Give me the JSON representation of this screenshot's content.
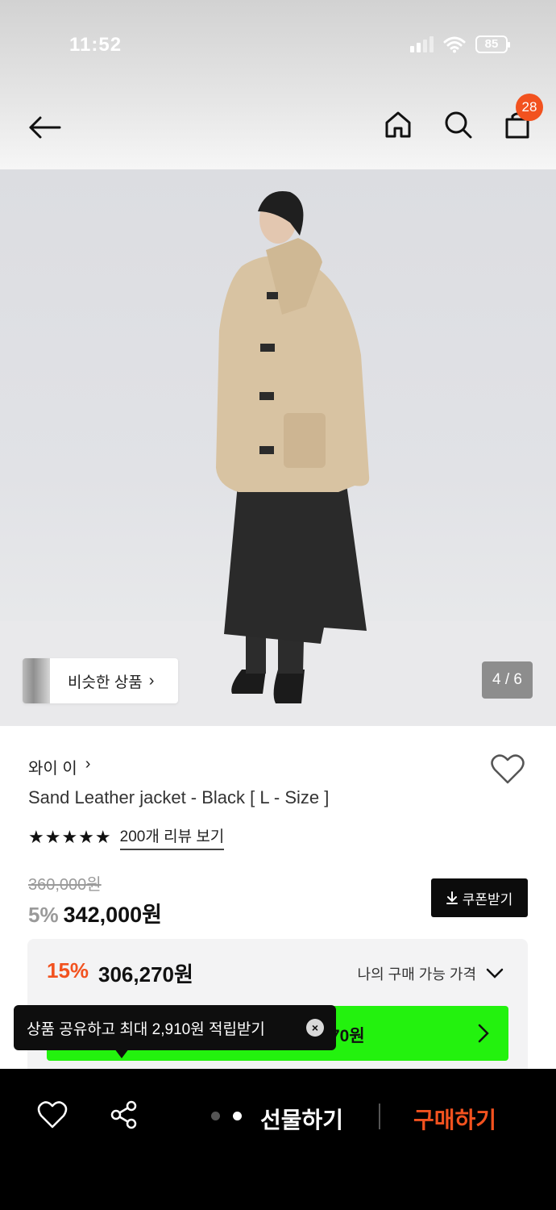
{
  "status_bar": {
    "time": "11:52",
    "battery": "85"
  },
  "header": {
    "cart_count": "28"
  },
  "gallery": {
    "similar_label": "비슷한 상품",
    "similar_chevron": "›",
    "page_indicator": "4 / 6"
  },
  "product": {
    "brand": "와이 이",
    "brand_chevron": "›",
    "title": "Sand Leather jacket - Black [ L - Size ]",
    "stars": "★★★★★",
    "review_link": "200개 리뷰 보기",
    "original_price": "360,000원",
    "discount": "5%",
    "price": "342,000원",
    "coupon_label": "쿠폰받기"
  },
  "my_price": {
    "discount": "15%",
    "price": "306,270원",
    "label": "나의 구매 가능 가격"
  },
  "promo": {
    "partial_text": "70원"
  },
  "tooltip": {
    "text": "상품 공유하고 최대 2,910원 적립받기",
    "close": "×"
  },
  "bottom": {
    "gift_label": "선물하기",
    "buy_label": "구매하기"
  },
  "colors": {
    "accent": "#f2521f",
    "promo_green": "#23f20e",
    "coat": "#d8c3a2",
    "skirt": "#2a2a2a"
  },
  "icons": [
    "back-arrow-icon",
    "home-icon",
    "search-icon",
    "cart-icon",
    "heart-icon",
    "chevron-down-icon",
    "download-icon",
    "share-icon",
    "close-icon"
  ]
}
